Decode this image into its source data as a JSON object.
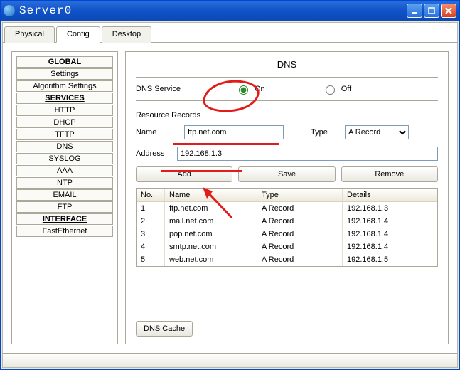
{
  "window": {
    "title": "Server0"
  },
  "tabs": {
    "physical": "Physical",
    "config": "Config",
    "desktop": "Desktop"
  },
  "sidebar": {
    "global": {
      "head": "GLOBAL",
      "settings": "Settings",
      "algo": "Algorithm Settings"
    },
    "services": {
      "head": "SERVICES",
      "http": "HTTP",
      "dhcp": "DHCP",
      "tftp": "TFTP",
      "dns": "DNS",
      "syslog": "SYSLOG",
      "aaa": "AAA",
      "ntp": "NTP",
      "email": "EMAIL",
      "ftp": "FTP"
    },
    "interface": {
      "head": "INTERFACE",
      "fe": "FastEthernet"
    }
  },
  "main": {
    "heading": "DNS",
    "service_label": "DNS Service",
    "on": "On",
    "off": "Off",
    "resource_records": "Resource Records",
    "name_label": "Name",
    "name_value": "ftp.net.com",
    "type_label": "Type",
    "type_value": "A Record",
    "address_label": "Address",
    "address_value": "192.168.1.3",
    "add": "Add",
    "save": "Save",
    "remove": "Remove",
    "cols": {
      "no": "No.",
      "name": "Name",
      "type": "Type",
      "details": "Details"
    },
    "records": [
      {
        "no": "1",
        "name": "ftp.net.com",
        "type": "A Record",
        "details": "192.168.1.3"
      },
      {
        "no": "2",
        "name": "mail.net.com",
        "type": "A Record",
        "details": "192.168.1.4"
      },
      {
        "no": "3",
        "name": "pop.net.com",
        "type": "A Record",
        "details": "192.168.1.4"
      },
      {
        "no": "4",
        "name": "smtp.net.com",
        "type": "A Record",
        "details": "192.168.1.4"
      },
      {
        "no": "5",
        "name": "web.net.com",
        "type": "A Record",
        "details": "192.168.1.5"
      }
    ],
    "dns_cache": "DNS Cache"
  }
}
